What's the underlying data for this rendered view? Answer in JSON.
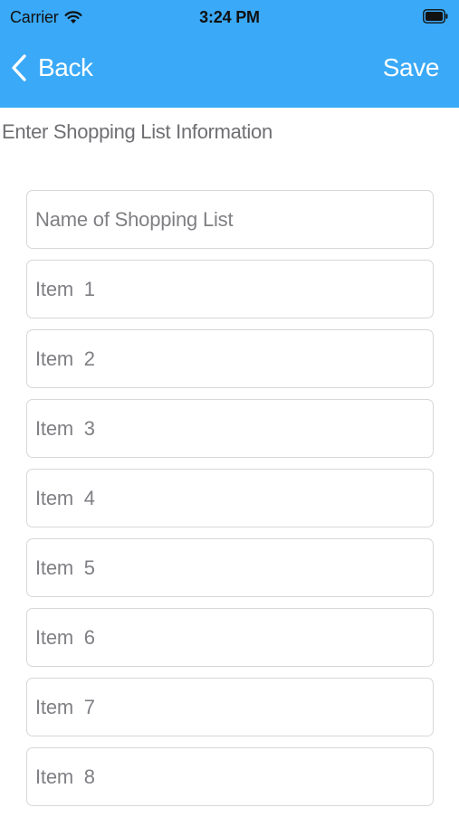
{
  "status_bar": {
    "carrier": "Carrier",
    "time": "3:24 PM",
    "wifi_icon": "wifi-icon",
    "battery_icon": "battery-icon"
  },
  "nav": {
    "back_label": "Back",
    "save_label": "Save",
    "background": "#3aa9f7",
    "foreground": "#ffffff"
  },
  "form": {
    "heading": "Enter Shopping List Information",
    "name_placeholder": "Name of Shopping List",
    "items": [
      {
        "placeholder": "Item  1"
      },
      {
        "placeholder": "Item  2"
      },
      {
        "placeholder": "Item  3"
      },
      {
        "placeholder": "Item  4"
      },
      {
        "placeholder": "Item  5"
      },
      {
        "placeholder": "Item  6"
      },
      {
        "placeholder": "Item  7"
      },
      {
        "placeholder": "Item  8"
      }
    ]
  }
}
